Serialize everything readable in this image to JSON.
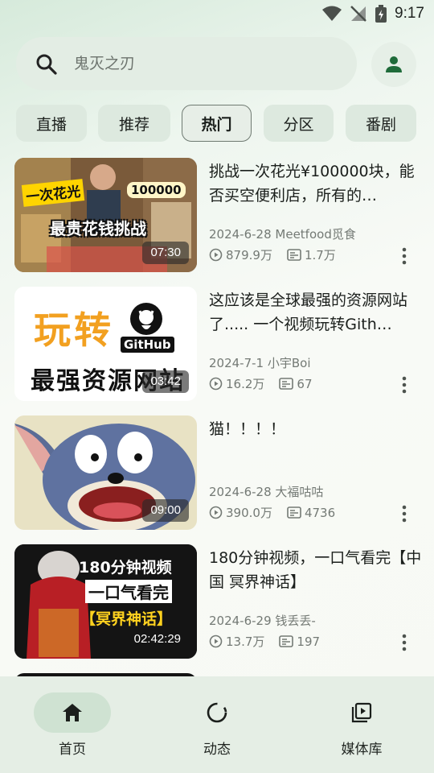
{
  "status": {
    "time": "9:17"
  },
  "search": {
    "placeholder": "鬼灭之刃"
  },
  "chips": [
    {
      "label": "直播"
    },
    {
      "label": "推荐"
    },
    {
      "label": "热门"
    },
    {
      "label": "分区"
    },
    {
      "label": "番剧"
    }
  ],
  "videos": [
    {
      "title": "挑战一次花光¥100000块，能否买空便利店，所有的…",
      "date_author": "2024-6-28 Meetfood觅食",
      "views": "879.9万",
      "danmaku": "1.7万",
      "duration": "07:30",
      "thumb_text_1": "一次花光",
      "thumb_text_2": "100000",
      "thumb_text_3": "最贵花钱挑战"
    },
    {
      "title": "这应该是全球最强的资源网站了..... 一个视频玩转Gith…",
      "date_author": "2024-7-1 小宇Boi",
      "views": "16.2万",
      "danmaku": "67",
      "duration": "03:42",
      "thumb_text_1": "玩转",
      "thumb_text_2": "GitHub",
      "thumb_text_3": "最强资源网站"
    },
    {
      "title": "猫！！！！",
      "date_author": "2024-6-28 大福咕咕",
      "views": "390.0万",
      "danmaku": "4736",
      "duration": "09:00"
    },
    {
      "title": "180分钟视频，一口气看完【中国 冥界神话】",
      "date_author": "2024-6-29 钱丢丢-",
      "views": "13.7万",
      "danmaku": "197",
      "duration": "02:42:29",
      "thumb_text_1": "180分钟视频",
      "thumb_text_2": "一口气看完",
      "thumb_text_3": "【冥界神话】"
    }
  ],
  "nav": [
    {
      "label": "首页",
      "icon": "home-icon"
    },
    {
      "label": "动态",
      "icon": "activity-icon"
    },
    {
      "label": "媒体库",
      "icon": "library-icon"
    }
  ],
  "colors": {
    "accent": "#1f6b3a",
    "chip_bg": "#dde9df",
    "nav_active": "#cfe2d2"
  }
}
